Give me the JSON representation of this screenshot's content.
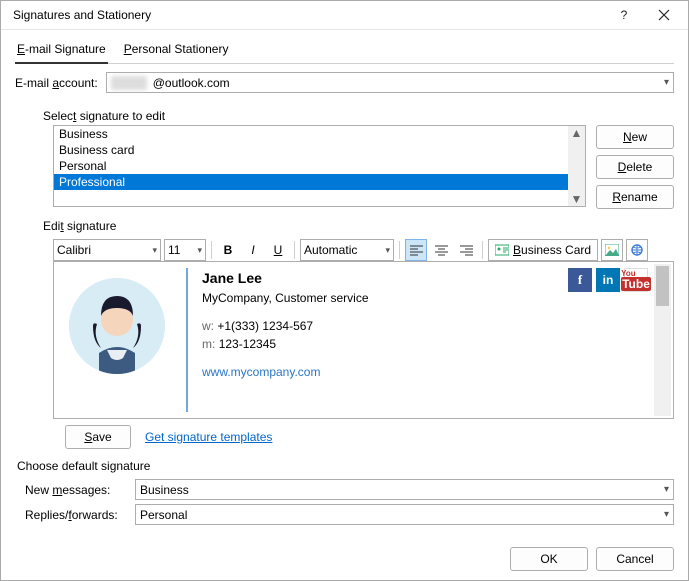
{
  "title": "Signatures and Stationery",
  "tabs": {
    "email": "E-mail Signature",
    "stationery": "Personal Stationery"
  },
  "account": {
    "label": "E-mail account:",
    "value": "@outlook.com"
  },
  "selectLabel": "Select signature to edit",
  "signatures": [
    "Business",
    "Business card",
    "Personal",
    "Professional"
  ],
  "selectedSignatureIndex": 3,
  "buttons": {
    "new": "New",
    "delete": "Delete",
    "rename": "Rename",
    "save": "Save",
    "ok": "OK",
    "cancel": "Cancel"
  },
  "editLabel": "Edit signature",
  "toolbar": {
    "font": "Calibri",
    "size": "11",
    "color": "Automatic",
    "bcard": "Business Card"
  },
  "sig": {
    "name": "Jane Lee",
    "company": "MyCompany, Customer service",
    "wLabel": "w:",
    "wVal": "+1(333) 1234-567",
    "mLabel": "m:",
    "mVal": "123-12345",
    "url": "www.mycompany.com"
  },
  "templatesLink": "Get signature templates",
  "defaults": {
    "label": "Choose default signature",
    "newMsg": {
      "label": "New messages:",
      "value": "Business"
    },
    "replies": {
      "label": "Replies/forwards:",
      "value": "Personal"
    }
  }
}
